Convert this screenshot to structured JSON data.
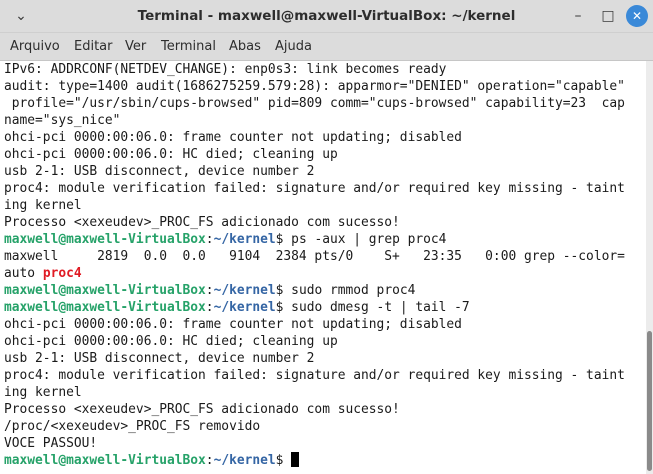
{
  "window": {
    "title": "Terminal - maxwell@maxwell-VirtualBox: ~/kernel"
  },
  "menu": [
    "Arquivo",
    "Editar",
    "Ver",
    "Terminal",
    "Abas",
    "Ajuda"
  ],
  "prompt": {
    "user_host": "maxwell@maxwell-VirtualBox",
    "sep": ":",
    "path": "~/kernel",
    "sigil": "$"
  },
  "output": {
    "l1": "IPv6: ADDRCONF(NETDEV_CHANGE): enp0s3: link becomes ready",
    "l2": "audit: type=1400 audit(1686275259.579:28): apparmor=\"DENIED\" operation=\"capable\"",
    "l3": " profile=\"/usr/sbin/cups-browsed\" pid=809 comm=\"cups-browsed\" capability=23  cap",
    "l4": "name=\"sys_nice\"",
    "l5": "ohci-pci 0000:00:06.0: frame counter not updating; disabled",
    "l6": "ohci-pci 0000:00:06.0: HC died; cleaning up",
    "l7": "usb 2-1: USB disconnect, device number 2",
    "l8": "proc4: module verification failed: signature and/or required key missing - taint",
    "l9": "ing kernel",
    "l10": "Processo <xexeudev>_PROC_FS adicionado com sucesso!",
    "cmd1": " ps -aux | grep proc4",
    "l12": "maxwell     2819  0.0  0.0   9104  2384 pts/0    S+   23:35   0:00 grep --color=",
    "l13_a": "auto ",
    "l13_b": "proc4",
    "cmd2": " sudo rmmod proc4",
    "cmd3": " sudo dmesg -t | tail -7",
    "l16": "ohci-pci 0000:00:06.0: frame counter not updating; disabled",
    "l17": "ohci-pci 0000:00:06.0: HC died; cleaning up",
    "l18": "usb 2-1: USB disconnect, device number 2",
    "l19": "proc4: module verification failed: signature and/or required key missing - taint",
    "l20": "ing kernel",
    "l21": "Processo <xexeudev>_PROC_FS adicionado com sucesso!",
    "l22": "/proc/<xexeudev>_PROC_FS removido",
    "l23": "VOCE PASSOU!",
    "cmd4": " "
  },
  "colors": {
    "prompt_user": "#26a269",
    "prompt_path": "#3465a4",
    "highlight": "#e01b24",
    "close_button": "#3a89d8"
  },
  "icons": {
    "menu": "chevron-down-icon",
    "minimize": "minimize-icon",
    "maximize": "maximize-icon",
    "close": "close-icon"
  }
}
